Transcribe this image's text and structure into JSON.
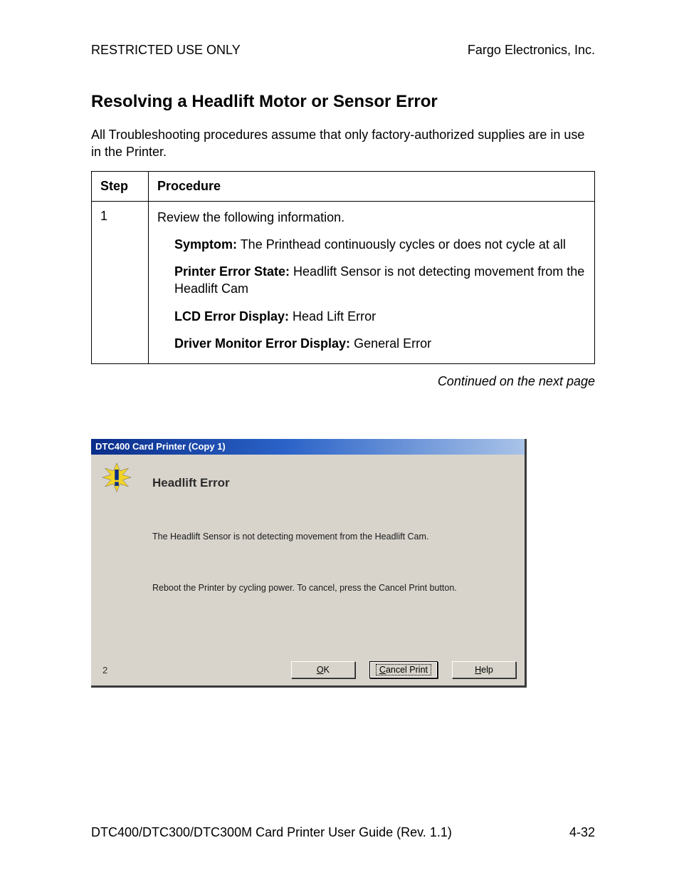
{
  "header": {
    "left": "RESTRICTED USE ONLY",
    "right": "Fargo Electronics, Inc."
  },
  "title": "Resolving a Headlift Motor or Sensor Error",
  "intro": "All Troubleshooting procedures assume that only factory-authorized supplies are in use in the Printer.",
  "table": {
    "h1": "Step",
    "h2": "Procedure",
    "step": "1",
    "p0": "Review the following information.",
    "p1a": "Symptom:",
    "p1b": " The Printhead continuously cycles or does not cycle at all",
    "p2a": "Printer Error State:",
    "p2b": " Headlift Sensor is not detecting movement from the Headlift Cam",
    "p3a": "LCD Error Display:",
    "p3b": " Head Lift Error",
    "p4a": "Driver Monitor Error Display:",
    "p4b": " General Error"
  },
  "continued": "Continued on the next page",
  "dialog": {
    "title": "DTC400 Card Printer (Copy 1)",
    "heading": "Headlift Error",
    "line1": "The Headlift Sensor is not detecting movement from the Headlift Cam.",
    "line2": "Reboot the Printer by cycling power. To cancel, press the Cancel Print button.",
    "count": "2",
    "ok": "K",
    "cancel": "ancel Print",
    "help": "elp"
  },
  "footer": {
    "left": "DTC400/DTC300/DTC300M Card Printer User Guide (Rev. 1.1)",
    "right": "4-32"
  }
}
